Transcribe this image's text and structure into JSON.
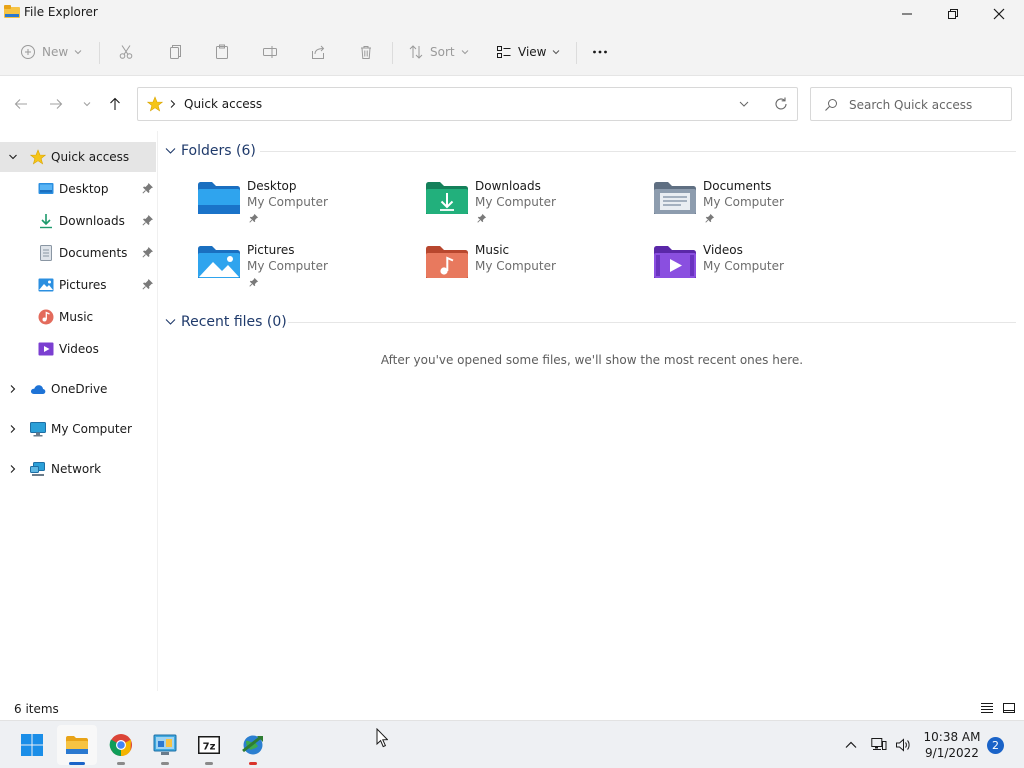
{
  "window": {
    "title": "File Explorer"
  },
  "toolbar": {
    "new_label": "New",
    "sort_label": "Sort",
    "view_label": "View"
  },
  "address": {
    "location": "Quick access"
  },
  "search": {
    "placeholder": "Search Quick access"
  },
  "sidebar": {
    "quick_access": "Quick access",
    "items": [
      {
        "label": "Desktop",
        "icon": "desktop-icon",
        "pinned": true
      },
      {
        "label": "Downloads",
        "icon": "downloads-icon",
        "pinned": true
      },
      {
        "label": "Documents",
        "icon": "documents-icon",
        "pinned": true
      },
      {
        "label": "Pictures",
        "icon": "pictures-icon",
        "pinned": true
      },
      {
        "label": "Music",
        "icon": "music-icon",
        "pinned": false
      },
      {
        "label": "Videos",
        "icon": "videos-icon",
        "pinned": false
      }
    ],
    "onedrive": "OneDrive",
    "my_computer": "My Computer",
    "network": "Network"
  },
  "folders_section": {
    "title": "Folders (6)"
  },
  "folders": [
    {
      "name": "Desktop",
      "location": "My Computer",
      "pinned": true
    },
    {
      "name": "Downloads",
      "location": "My Computer",
      "pinned": true
    },
    {
      "name": "Documents",
      "location": "My Computer",
      "pinned": true
    },
    {
      "name": "Pictures",
      "location": "My Computer",
      "pinned": true
    },
    {
      "name": "Music",
      "location": "My Computer",
      "pinned": false
    },
    {
      "name": "Videos",
      "location": "My Computer",
      "pinned": false
    }
  ],
  "recent_section": {
    "title": "Recent files (0)",
    "empty_message": "After you've opened some files, we'll show the most recent ones here."
  },
  "status": {
    "count": "6 items"
  },
  "taskbar": {
    "apps": [
      "start-icon",
      "file-explorer-icon",
      "chrome-icon",
      "control-panel-icon",
      "7zip-icon",
      "network-globe-icon"
    ],
    "time": "10:38 AM",
    "date": "9/1/2022",
    "notifications": "2"
  },
  "colors": {
    "accent": "#1a63c8",
    "heading": "#1f3a6b",
    "selected": "#e5e5e5"
  }
}
